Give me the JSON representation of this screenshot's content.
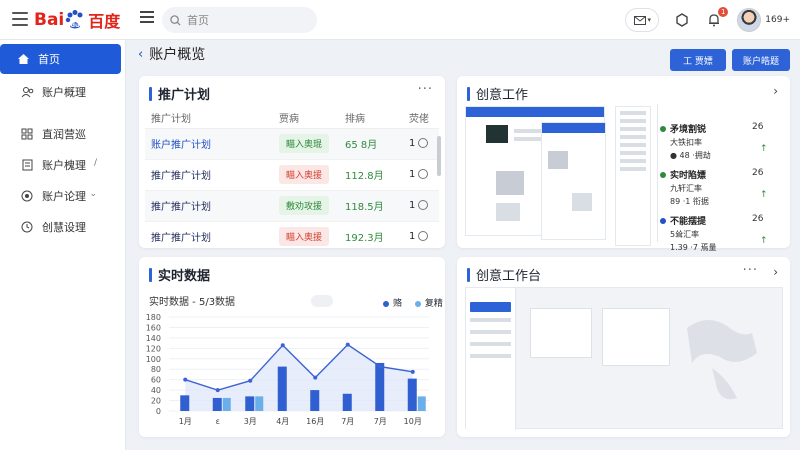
{
  "header": {
    "brand_bai": "Bai",
    "brand_du": "百度",
    "search_placeholder": "首页",
    "username": "169+",
    "notification_count": "1"
  },
  "sidebar": {
    "items": [
      {
        "label": "首页",
        "icon": "home-icon",
        "active": true
      },
      {
        "label": "账户概理",
        "icon": "users-icon"
      },
      {
        "label": "直润营巡",
        "icon": "grid-icon"
      },
      {
        "label": "账户槐理",
        "icon": "document-icon",
        "caret": "/"
      },
      {
        "label": "账户论理",
        "icon": "target-icon",
        "caret": "⌄"
      },
      {
        "label": "创慧设理",
        "icon": "clock-icon"
      }
    ]
  },
  "page": {
    "title": "账户概览",
    "btn1": "工 贾嫖",
    "btn2": "账户皓题"
  },
  "plan_card": {
    "title": "推广计划",
    "more": "···",
    "columns": [
      "推广计划",
      "贾病",
      "排病",
      "荧佬"
    ],
    "rows": [
      {
        "name": "账户推广计划",
        "status": "瞄入奥琨",
        "status_color": "green",
        "budget": "65 8月",
        "toggle": "1"
      },
      {
        "name": "推广推广计划",
        "status": "瞄入奥援",
        "status_color": "red",
        "budget": "112.8月",
        "toggle": "1"
      },
      {
        "name": "推广推广计划",
        "status": "敷劝攻援",
        "status_color": "green",
        "budget": "118.5月",
        "toggle": "1"
      },
      {
        "name": "推广推广计划",
        "status": "瞄入奥援",
        "status_color": "red",
        "budget": "192.3月",
        "toggle": "1"
      }
    ]
  },
  "creative_card": {
    "title": "创意工作"
  },
  "realtime_card": {
    "title": "实时数据",
    "chart_title": "实时数据 - 5/3数据",
    "legend_a": "赂",
    "legend_b": "复精"
  },
  "studio_card": {
    "title": "创意工作台",
    "more": "···"
  },
  "stats": [
    {
      "title": "矛境割锐",
      "sub1": "大铁扣率",
      "sub2": "● 48 ·拥劫",
      "val": "26"
    },
    {
      "title": "实时陷嫖",
      "sub1": "九轩汇率",
      "sub2": "89 ·1 衔据",
      "val": "26"
    },
    {
      "title": "不能摆提",
      "sub1": "5耸汇率",
      "sub2": "1.39 ·7 焉量",
      "val": "26"
    }
  ],
  "chart_data": {
    "type": "bar",
    "categories": [
      "1月",
      "ε",
      "3月",
      "4月",
      "16月",
      "7月",
      "7月",
      "10月"
    ],
    "ylim": [
      0,
      180
    ],
    "yticks": [
      0,
      20,
      40,
      60,
      80,
      100,
      120,
      140,
      160,
      180
    ],
    "series": [
      {
        "name": "赂",
        "color": "#2f5fd0",
        "values": [
          30,
          25,
          28,
          85,
          40,
          33,
          92,
          62
        ]
      },
      {
        "name": "复精",
        "color": "#6aaeea",
        "values": [
          0,
          25,
          28,
          0,
          0,
          0,
          0,
          28
        ]
      }
    ],
    "line": [
      60,
      40,
      58,
      126,
      64,
      127,
      85,
      75
    ]
  }
}
